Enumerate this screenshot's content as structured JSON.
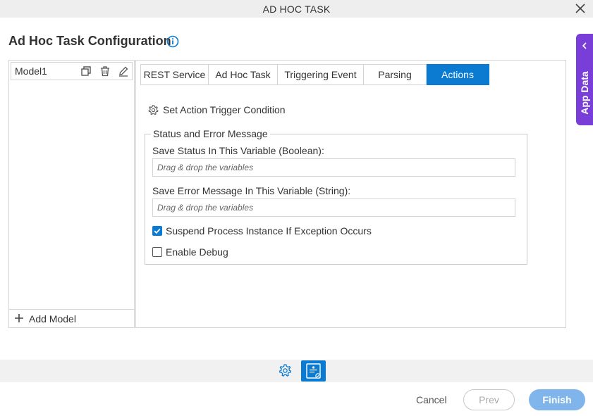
{
  "window": {
    "title": "AD HOC TASK"
  },
  "page": {
    "title": "Ad Hoc Task Configuration"
  },
  "models": {
    "items": [
      {
        "name": "Model1"
      }
    ],
    "add_label": "Add Model"
  },
  "tabs": [
    {
      "label": "REST Service",
      "active": false
    },
    {
      "label": "Ad Hoc Task",
      "active": false
    },
    {
      "label": "Triggering Event",
      "active": false
    },
    {
      "label": "Parsing",
      "active": false
    },
    {
      "label": "Actions",
      "active": true
    }
  ],
  "actions": {
    "trigger_label": "Set Action Trigger Condition",
    "status_section": {
      "legend": "Status and Error Message",
      "status_var_label": "Save Status In This Variable (Boolean):",
      "status_var_placeholder": "Drag & drop the variables",
      "error_var_label": "Save Error Message In This Variable (String):",
      "error_var_placeholder": "Drag & drop the variables",
      "suspend_label": "Suspend Process Instance If Exception Occurs",
      "suspend_checked": true,
      "debug_label": "Enable Debug",
      "debug_checked": false
    }
  },
  "side_panel": {
    "label": "App Data"
  },
  "footer": {
    "cancel": "Cancel",
    "prev": "Prev",
    "finish": "Finish"
  },
  "colors": {
    "accent": "#0b7ad1",
    "app_data": "#7a3ed8",
    "finish_disabled": "#7fb5ea"
  },
  "icons": [
    "close-icon",
    "info-icon",
    "copy-icon",
    "delete-icon",
    "edit-icon",
    "plus-icon",
    "gear-icon",
    "chevron-left-icon",
    "settings-icon",
    "app-config-icon"
  ]
}
